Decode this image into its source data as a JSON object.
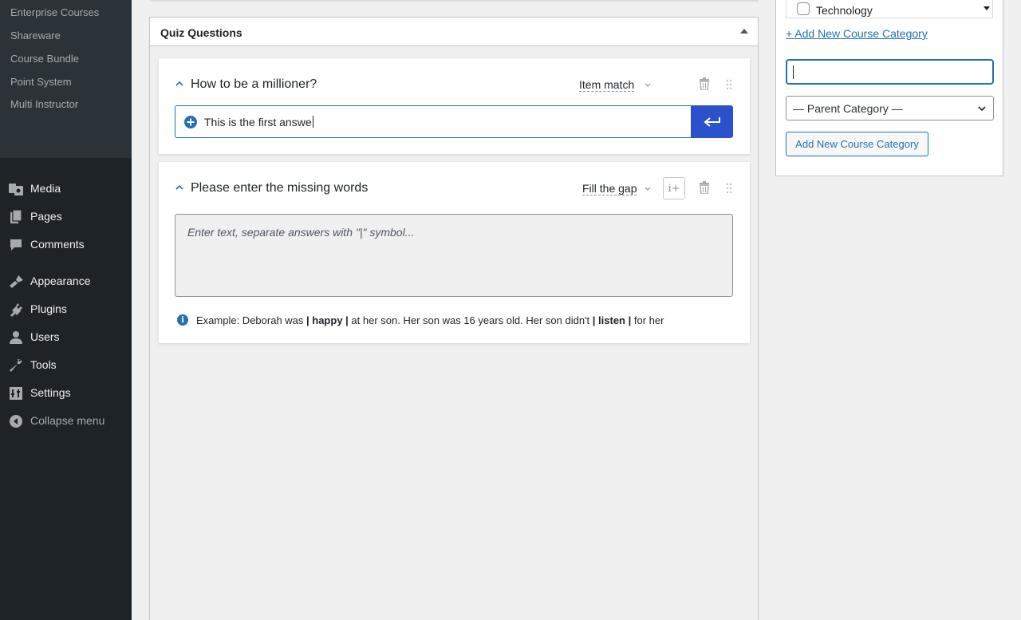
{
  "sidebar": {
    "submenu": [
      "Enterprise Courses",
      "Shareware",
      "Course Bundle",
      "Point System",
      "Multi Instructor"
    ],
    "items": [
      {
        "label": "Media",
        "icon": "media-icon"
      },
      {
        "label": "Pages",
        "icon": "pages-icon"
      },
      {
        "label": "Comments",
        "icon": "comments-icon"
      },
      {
        "label": "Appearance",
        "icon": "appearance-icon"
      },
      {
        "label": "Plugins",
        "icon": "plugins-icon"
      },
      {
        "label": "Users",
        "icon": "users-icon"
      },
      {
        "label": "Tools",
        "icon": "tools-icon"
      },
      {
        "label": "Settings",
        "icon": "settings-icon"
      },
      {
        "label": "Collapse menu",
        "icon": "collapse-icon"
      }
    ]
  },
  "quiz": {
    "title": "Quiz Questions",
    "questions": [
      {
        "title": "How to be a millioner?",
        "type": "Item match",
        "answer_input_value": "This is the first answe"
      },
      {
        "title": "Please enter the missing words",
        "type": "Fill the gap",
        "hint_label": "i+",
        "textarea_placeholder": "Enter text, separate answers with \"|\" symbol...",
        "example": {
          "prefix": "Example: Deborah was ",
          "bold1": "| happy |",
          "middle": " at her son. Her son was 16 years old. Her son didn't ",
          "bold2": "| listen |",
          "suffix": " for her"
        }
      }
    ]
  },
  "categories": {
    "visible_item": "Technology",
    "add_link": "+ Add New Course Category",
    "new_category_value": "",
    "parent_select": "— Parent Category —",
    "add_button": "Add New Course Category"
  },
  "colors": {
    "accent": "#2271b1",
    "enter_button": "#2b52cc",
    "sidebar_bg": "#1d2327",
    "submenu_bg": "#2c3338"
  }
}
